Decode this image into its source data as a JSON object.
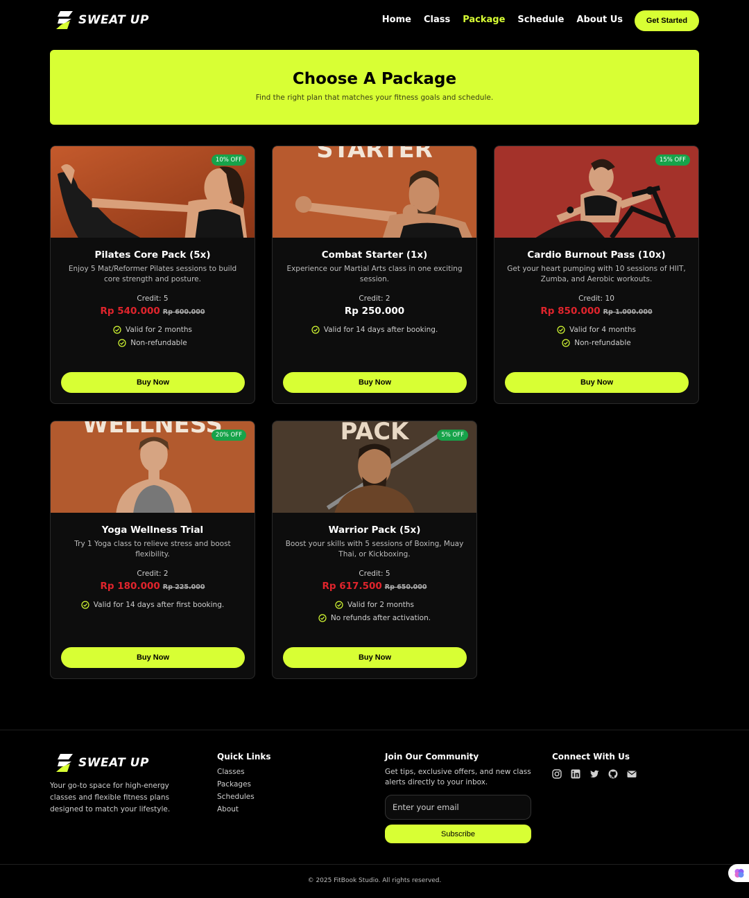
{
  "brand": {
    "name": "SWEAT UP",
    "accent": "#d8ff34",
    "discount_badge_color": "#17a34a",
    "price_color": "#e0242c"
  },
  "nav": {
    "links": [
      {
        "label": "Home"
      },
      {
        "label": "Class"
      },
      {
        "label": "Package",
        "active": true
      },
      {
        "label": "Schedule"
      },
      {
        "label": "About Us"
      }
    ],
    "cta": "Get Started"
  },
  "hero": {
    "title": "Choose A Package",
    "subtitle": "Find the right plan that matches your fitness goals and schedule."
  },
  "packages": [
    {
      "title": "Pilates Core Pack (5x)",
      "description": "Enjoy 5 Mat/Reformer Pilates sessions to build core strength and posture.",
      "credit": "Credit: 5",
      "price": "Rp 540.000",
      "old_price": "Rp 600.000",
      "badge": "10% OFF",
      "features": [
        "Valid for 2 months",
        "Non-refundable"
      ],
      "button": "Buy Now",
      "image": "woman-pilates-pose"
    },
    {
      "title": "Combat Starter (1x)",
      "description": "Experience our Martial Arts class in one exciting session.",
      "credit": "Credit: 2",
      "price": "Rp 250.000",
      "old_price": "",
      "badge": "",
      "features": [
        "Valid for 14 days after booking."
      ],
      "button": "Buy Now",
      "image": "man-punching",
      "image_text": "STARTER"
    },
    {
      "title": "Cardio Burnout Pass (10x)",
      "description": "Get your heart pumping with 10 sessions of HIIT, Zumba, and Aerobic workouts.",
      "credit": "Credit: 10",
      "price": "Rp 850.000",
      "old_price": "Rp 1.000.000",
      "badge": "15% OFF",
      "features": [
        "Valid for 4 months",
        "Non-refundable"
      ],
      "button": "Buy Now",
      "image": "woman-air-bike"
    },
    {
      "title": "Yoga Wellness Trial",
      "description": "Try 1 Yoga class to relieve stress and boost flexibility.",
      "credit": "Credit: 2",
      "price": "Rp 180.000",
      "old_price": "Rp 225.000",
      "badge": "20% OFF",
      "features": [
        "Valid for 14 days after first booking."
      ],
      "button": "Buy Now",
      "image": "woman-meditating",
      "image_text": "WELLNESS"
    },
    {
      "title": "Warrior Pack (5x)",
      "description": "Boost your skills with 5 sessions of Boxing, Muay Thai, or Kickboxing.",
      "credit": "Credit: 5",
      "price": "Rp 617.500",
      "old_price": "Rp 650.000",
      "badge": "5% OFF",
      "features": [
        "Valid for 2 months",
        "No refunds after activation."
      ],
      "button": "Buy Now",
      "image": "warrior-with-sword",
      "image_text": "PACK"
    }
  ],
  "footer": {
    "about": "Your go-to space for high-energy classes and flexible fitness plans designed to match your lifestyle.",
    "quick_links_title": "Quick Links",
    "quick_links": [
      "Classes",
      "Packages",
      "Schedules",
      "About"
    ],
    "community_title": "Join Our Community",
    "community_text": "Get tips, exclusive offers, and new class alerts directly to your inbox.",
    "email_placeholder": "Enter your email",
    "subscribe": "Subscribe",
    "connect_title": "Connect With Us",
    "socials": [
      "instagram-icon",
      "linkedin-icon",
      "twitter-icon",
      "github-icon",
      "mail-icon"
    ],
    "copyright": "© 2025 FitBook Studio. All rights reserved."
  }
}
